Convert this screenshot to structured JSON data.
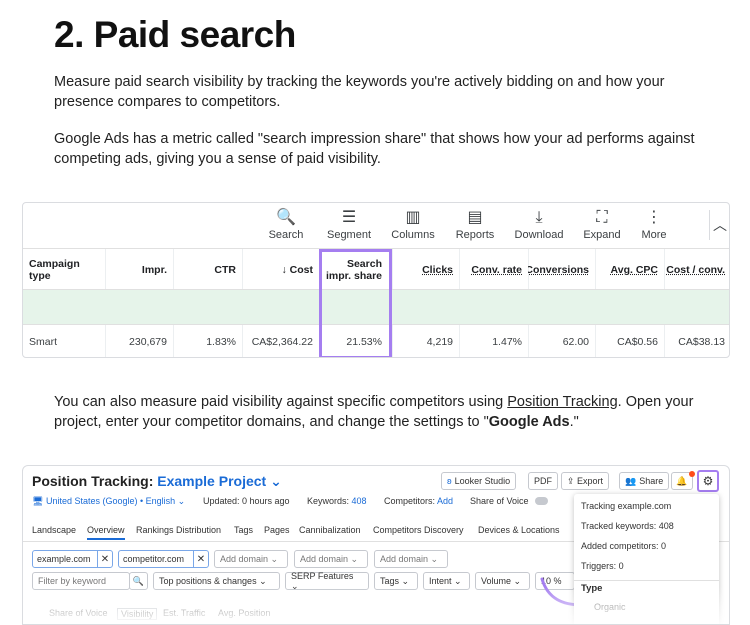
{
  "article": {
    "heading": "2. Paid search",
    "p1": "Measure paid search visibility by tracking the keywords you're actively bidding on and how your presence compares to competitors.",
    "p2": "Google Ads has a metric called \"search impression share\" that shows how your ad performs against competing ads, giving you a sense of paid visibility.",
    "p3_before": "You can also measure paid visibility against specific competitors using ",
    "p3_link": "Position Tracking",
    "p3_middle": ". Open your project, enter your competitor domains, and change the settings to \"",
    "p3_bold": "Google Ads",
    "p3_after": ".\""
  },
  "google_ads": {
    "toolbar": [
      {
        "label": "Search",
        "icon": "search-icon",
        "glyph": "🔍"
      },
      {
        "label": "Segment",
        "icon": "segment-icon",
        "glyph": "☰"
      },
      {
        "label": "Columns",
        "icon": "columns-icon",
        "glyph": "▥"
      },
      {
        "label": "Reports",
        "icon": "reports-icon",
        "glyph": "▤"
      },
      {
        "label": "Download",
        "icon": "download-icon",
        "glyph": "⤓"
      },
      {
        "label": "Expand",
        "icon": "expand-icon",
        "glyph": "⛶"
      },
      {
        "label": "More",
        "icon": "more-icon",
        "glyph": "⋮"
      }
    ],
    "collapse_glyph": "︿",
    "headers": [
      "Campaign type",
      "Impr.",
      "CTR",
      "↓ Cost",
      "Search impr. share",
      "Clicks",
      "Conv. rate",
      "Conversions",
      "Avg. CPC",
      "Cost / conv."
    ],
    "row": [
      "Smart",
      "230,679",
      "1.83%",
      "CA$2,364.22",
      "21.53%",
      "4,219",
      "1.47%",
      "62.00",
      "CA$0.56",
      "CA$38.13"
    ],
    "highlight_color": "#a57ef0",
    "green_row_color": "#e6f4ea"
  },
  "semrush": {
    "title": "Position Tracking:",
    "project": "Example Project ⌄",
    "buttons": [
      "Looker Studio",
      "PDF",
      "⇪ Export",
      "Share"
    ],
    "location": "United States (Google) • English ⌄",
    "updated": "Updated: 0 hours ago",
    "keywords_label": "Keywords:",
    "keywords_value": "408",
    "competitors_label": "Competitors:",
    "competitors_value": "Add",
    "share_of_voice": "Share of Voice",
    "nav": [
      "Landscape",
      "Overview",
      "Rankings Distribution",
      "Tags",
      "Pages",
      "Cannibalization",
      "Competitors Discovery",
      "Devices & Locations"
    ],
    "chips": [
      "example.com",
      "competitor.com"
    ],
    "add_domain": "Add domain ⌄",
    "filter_placeholder": "Filter by keyword",
    "filters": [
      "Top positions & changes ⌄",
      "SERP Features ⌄",
      "Tags ⌄",
      "Intent ⌄",
      "Volume ⌄",
      "10 %"
    ],
    "sub_tabs": [
      "Share of Voice",
      "Visibility",
      "Est. Traffic",
      "Avg. Position"
    ],
    "popup": {
      "items": [
        "Tracking example.com",
        "Tracked keywords: 408",
        "Added competitors: 0",
        "Triggers: 0"
      ],
      "type_heading": "Type",
      "type_option": "Organic"
    },
    "accent_color": "#1a6bd6",
    "gear_highlight_color": "#a57ef0"
  }
}
